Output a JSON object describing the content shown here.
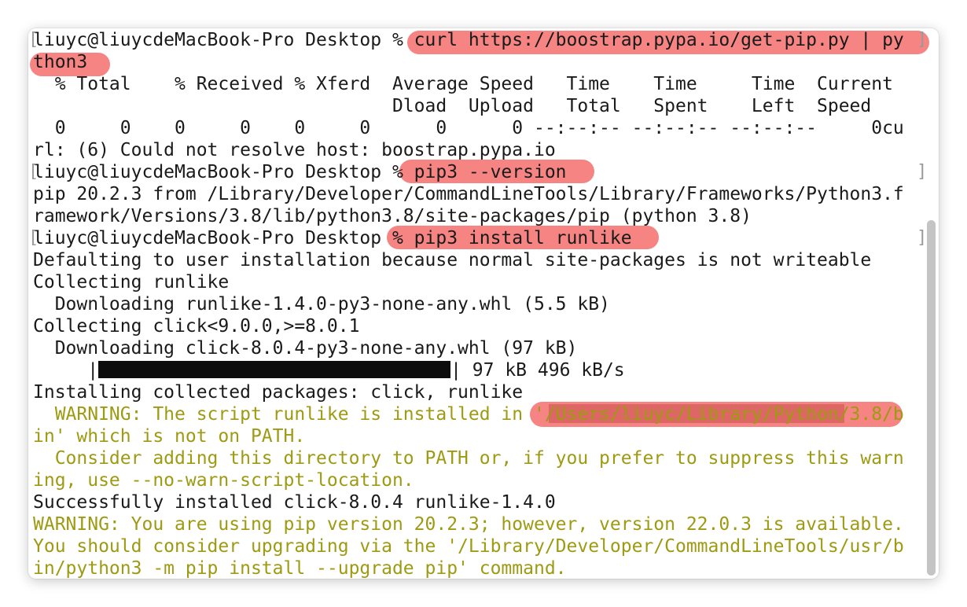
{
  "prompt": "liuyc@liuycdeMacBook-Pro Desktop % ",
  "lines": {
    "cmd1": "curl https://boostrap.pypa.io/get-pip.py | py",
    "cmd1_cont": "thon3",
    "hdr1": "  % Total    % Received % Xferd  Average Speed   Time    Time     Time  Current",
    "hdr2": "                                 Dload  Upload   Total   Spent    Left  Speed",
    "progress_row": "  0     0    0     0    0     0      0      0 --:--:-- --:--:-- --:--:--     0cu",
    "curl_error": "rl: (6) Could not resolve host: boostrap.pypa.io",
    "cmd2": "pip3 --version",
    "pip_version_1": "pip 20.2.3 from /Library/Developer/CommandLineTools/Library/Frameworks/Python3.f",
    "pip_version_2": "ramework/Versions/3.8/lib/python3.8/site-packages/pip (python 3.8)",
    "cmd3": "pip3 install runlike",
    "defaulting": "Defaulting to user installation because normal site-packages is not writeable",
    "collecting_runlike": "Collecting runlike",
    "downloading_runlike": "  Downloading runlike-1.4.0-py3-none-any.whl (5.5 kB)",
    "collecting_click": "Collecting click<9.0.0,>=8.0.1",
    "downloading_click": "  Downloading click-8.0.4-py3-none-any.whl (97 kB)",
    "bar_prefix": "     |",
    "bar_suffix": "| 97 kB 496 kB/s",
    "installing": "Installing collected packages: click, runlike",
    "warn1_a": "  WARNING: The script runlike is installed in '/Users/liuyc/Library/Python/3.8/b",
    "warn1_b": "in' which is not on PATH.",
    "warn2_a": "  Consider adding this directory to PATH or, if you prefer to suppress this warn",
    "warn2_b": "ing, use --no-warn-script-location.",
    "success": "Successfully installed click-8.0.4 runlike-1.4.0",
    "warn3_a": "WARNING: You are using pip version 20.2.3; however, version 22.0.3 is available.",
    "warn3_b": "You should consider upgrading via the '/Library/Developer/CommandLineTools/usr/b",
    "warn3_c": "in/python3 -m pip install --upgrade pip' command."
  },
  "colors": {
    "text": "#1a1a1a",
    "warning": "#9e9a12",
    "highlight": "#f47a78"
  }
}
